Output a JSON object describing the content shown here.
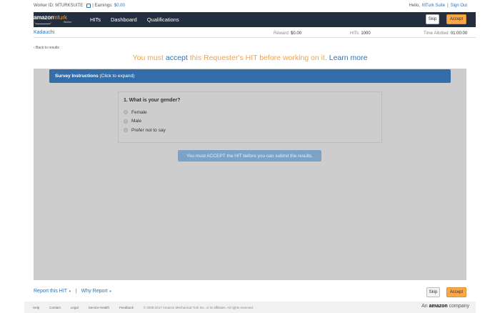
{
  "topbar": {
    "worker_id_label": "Worker ID: MTURKSUITE",
    "earnings_label": "| Earnings:",
    "earnings_value": "$0.00",
    "hello_prefix": "Hello,",
    "user_name": "MTurk Suite",
    "separator": "|",
    "sign_out": "Sign Out"
  },
  "nav": {
    "logo_word1": "amazon",
    "logo_word2": "mturk",
    "logo_sub": "Worker",
    "links": [
      "HITs",
      "Dashboard",
      "Qualifications"
    ],
    "skip_label": "Skip",
    "accept_label": "Accept"
  },
  "hit": {
    "requester": "Kadauchi",
    "reward_label": "Reward:",
    "reward_value": "$0.00",
    "hits_label": "HITs:",
    "hits_value": "1000",
    "time_label": "Time Allotted:",
    "time_value": "01:00:00"
  },
  "back_link": "‹ Back to results",
  "headline": {
    "part1": "You must",
    "accept_link": "accept",
    "part2": "this Requester's HIT before working on it.",
    "learn_more": "Learn more"
  },
  "survey": {
    "instructions_bold": "Survey Instructions",
    "instructions_hint": "(Click to expand)",
    "question": "1. What is your gender?",
    "options": [
      "Female",
      "Male",
      "Prefer not to say"
    ],
    "notice": "You must ACCEPT the HIT before you can submit the results."
  },
  "footer": {
    "report": "Report this HIT",
    "separator": "|",
    "why_report": "Why Report",
    "skip_label": "Skip",
    "accept_label": "Accept"
  },
  "subfooter": {
    "links": [
      "Help",
      "Contact",
      "Legal",
      "Service Health",
      "Feedback"
    ],
    "copyright": "© 2005-2017 Amazon Mechanical Turk Inc. or its affiliates. All rights reserved.",
    "company_prefix": "An",
    "company_brand": "amazon",
    "company_suffix": "company"
  },
  "colors": {
    "nav_bg": "#232f3e",
    "accept": "#f7a94c",
    "link": "#2a73b6",
    "instructions_bar": "#336ea9",
    "work_area": "#cdcdcd"
  }
}
